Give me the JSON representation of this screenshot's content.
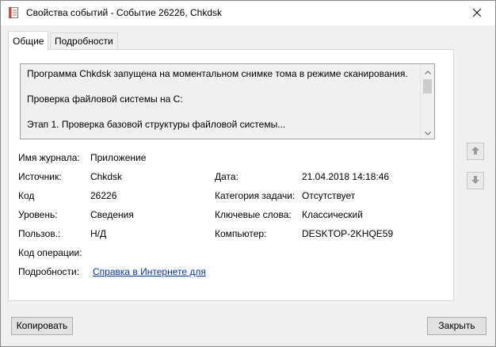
{
  "window": {
    "title": "Свойства событий - Событие 26226, Chkdsk"
  },
  "tabs": [
    {
      "label": "Общие"
    },
    {
      "label": "Подробности"
    }
  ],
  "description": {
    "lines": [
      "Программа Chkdsk запущена на моментальном снимке тома в режиме сканирования.",
      "Проверка файловой системы на C:",
      "Этап 1. Проверка базовой структуры файловой системы..."
    ]
  },
  "fields": {
    "log_name": {
      "label": "Имя журнала:",
      "value": "Приложение"
    },
    "source": {
      "label": "Источник:",
      "value": "Chkdsk"
    },
    "logged": {
      "label": "Дата:",
      "value": "21.04.2018 14:18:46"
    },
    "event_id": {
      "label": "Код",
      "value": "26226"
    },
    "task_category": {
      "label": "Категория задачи:",
      "value": "Отсутствует"
    },
    "level": {
      "label": "Уровень:",
      "value": "Сведения"
    },
    "keywords": {
      "label": "Ключевые слова:",
      "value": "Классический"
    },
    "user": {
      "label": "Пользов.:",
      "value": "Н/Д"
    },
    "computer": {
      "label": "Компьютер:",
      "value": "DESKTOP-2KHQE59"
    },
    "opcode": {
      "label": "Код операции:",
      "value": ""
    },
    "more_info": {
      "label": "Подробности:",
      "link": "Справка в Интернете для"
    }
  },
  "buttons": {
    "copy": "Копировать",
    "close": "Закрыть"
  },
  "icons": {
    "title": "event-log-icon",
    "close": "close-icon",
    "up": "arrow-up-icon",
    "down": "arrow-down-icon"
  },
  "colors": {
    "link": "#0033cc"
  }
}
